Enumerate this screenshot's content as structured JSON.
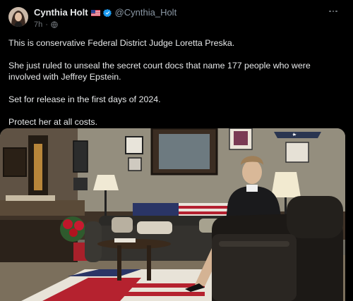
{
  "author": {
    "display_name": "Cynthia Holt",
    "handle": "@Cynthia_Holt",
    "time": "7h",
    "separator": "·",
    "flag_icon": "us-flag-icon",
    "badge_color": "#1d9bf0"
  },
  "post": {
    "paragraphs": [
      "This is conservative Federal District Judge Loretta Preska.",
      "She just ruled to unseal the secret court docs that name 177 people who were involved with Jeffrey Epstein.",
      "Set for release in the first days of 2024.",
      "Protect her at all costs."
    ]
  },
  "media": {
    "kind": "photo",
    "icon": "office-photo"
  }
}
